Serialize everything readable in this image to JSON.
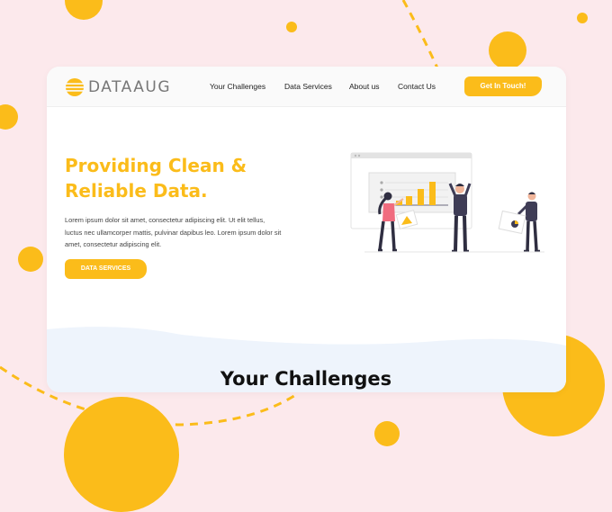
{
  "brand": {
    "name": "DATAAUG"
  },
  "nav": {
    "links": [
      "Your Challenges",
      "Data Services",
      "About us",
      "Contact Us"
    ],
    "cta_label": "Get In Touch!"
  },
  "hero": {
    "title_line1": "Providing Clean &",
    "title_line2": "Reliable Data.",
    "paragraph": "Lorem ipsum dolor sit amet, consectetur adipiscing elit. Ut elit tellus, luctus nec ullamcorper mattis, pulvinar dapibus leo. Lorem ipsum dolor sit amet, consectetur adipiscing elit.",
    "button_label": "DATA SERVICES"
  },
  "section": {
    "title": "Your Challenges"
  },
  "colors": {
    "accent": "#fbbc1a",
    "background": "#fce9ec",
    "card": "#ffffff",
    "wave": "#eef4fc",
    "figure_pink": "#f06c7f",
    "figure_dark": "#2f2e41"
  }
}
